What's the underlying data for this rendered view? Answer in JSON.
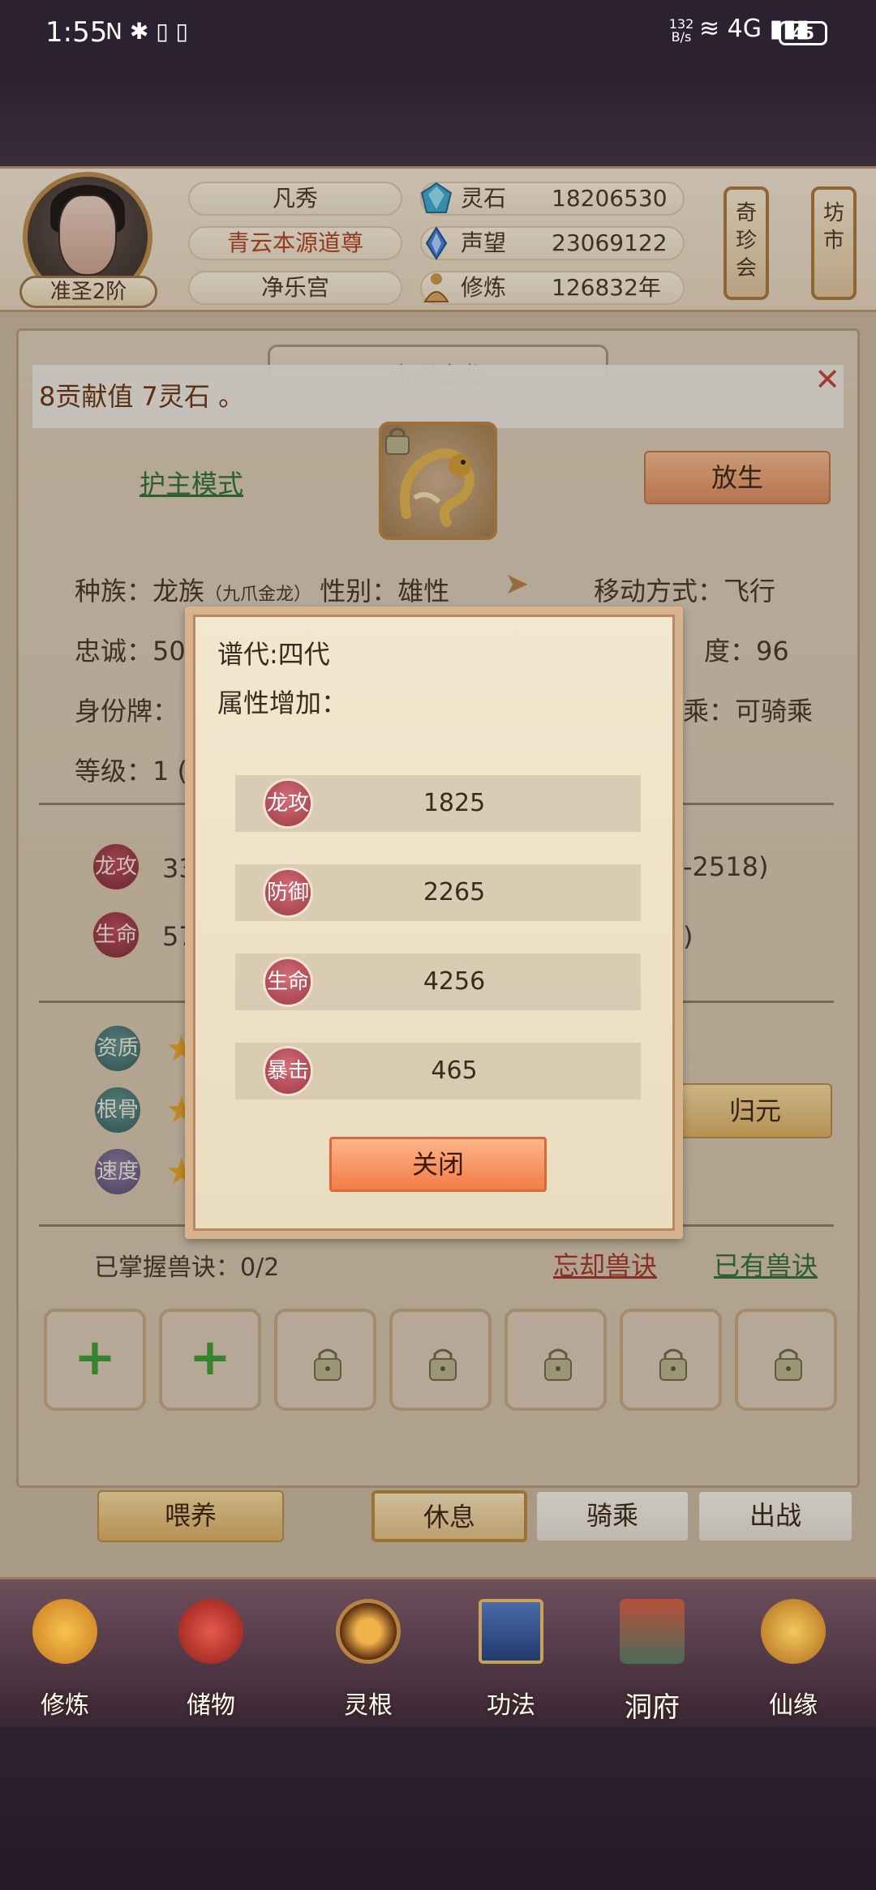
{
  "status_bar": {
    "time": "1:55",
    "left_icons": "N ✱ ▯ ▯",
    "net_speed_value": "132",
    "net_speed_unit": "B/s",
    "right_icons": "≋ 4G ▮▮▮",
    "battery": "45"
  },
  "header": {
    "avatar_rank": "准圣2阶",
    "name": "凡秀",
    "title": "青云本源道尊",
    "sect": "净乐宫",
    "stats": [
      {
        "icon": "spirit-stone-icon",
        "label": "灵石",
        "value": "18206530"
      },
      {
        "icon": "reputation-icon",
        "label": "声望",
        "value": "23069122"
      },
      {
        "icon": "cultivation-icon",
        "label": "修炼",
        "value": "126832年"
      }
    ],
    "side_buttons": [
      {
        "label": "奇珍会"
      },
      {
        "label": "坊市"
      }
    ]
  },
  "beast": {
    "name": "九爪金龙",
    "toast": "8贡献值 7灵石 。",
    "protect_mode": "护主模式",
    "release": "放生",
    "race": "种族：龙族",
    "race_note": "（九爪金龙）",
    "gender": "性别：雄性",
    "movement": "移动方式：飞行",
    "loyalty": "忠诚：50",
    "speed_tail": "度：96",
    "identity": "身份牌：",
    "ride_tail": "乘：可骑乘",
    "level": "等级：1 (",
    "attack_badge": "龙攻",
    "attack_value": "33",
    "attack_range_tail": "-2518)",
    "life_badge": "生命",
    "life_value": "57",
    "life_range_tail": ")",
    "aptitude_badges": [
      "资质",
      "根骨",
      "速度"
    ],
    "restore": "归元",
    "mastered": "已掌握兽诀：0/2",
    "forget": "忘却兽诀",
    "owned": "已有兽诀"
  },
  "actions": {
    "feed": "喂养",
    "rest": "休息",
    "ride": "骑乘",
    "fight": "出战"
  },
  "nav": [
    {
      "label": "修炼",
      "icon": "cultivate-icon"
    },
    {
      "label": "储物",
      "icon": "storage-bag-icon"
    },
    {
      "label": "灵根",
      "icon": "spirit-root-icon"
    },
    {
      "label": "功法",
      "icon": "technique-book-icon"
    },
    {
      "label": "洞府",
      "icon": "cave-mansion-icon"
    },
    {
      "label": "仙缘",
      "icon": "fortune-gourd-icon"
    }
  ],
  "modal": {
    "generation": "谱代:四代",
    "bonus_label": "属性增加：",
    "rows": [
      {
        "label": "龙攻",
        "value": "1825"
      },
      {
        "label": "防御",
        "value": "2265"
      },
      {
        "label": "生命",
        "value": "4256"
      },
      {
        "label": "暴击",
        "value": "465"
      }
    ],
    "close": "关闭"
  },
  "colors": {
    "accent_green": "#2f6f36",
    "accent_red": "#a3342a",
    "close_button": "#f27c47",
    "panel": "#d8cbb5"
  }
}
